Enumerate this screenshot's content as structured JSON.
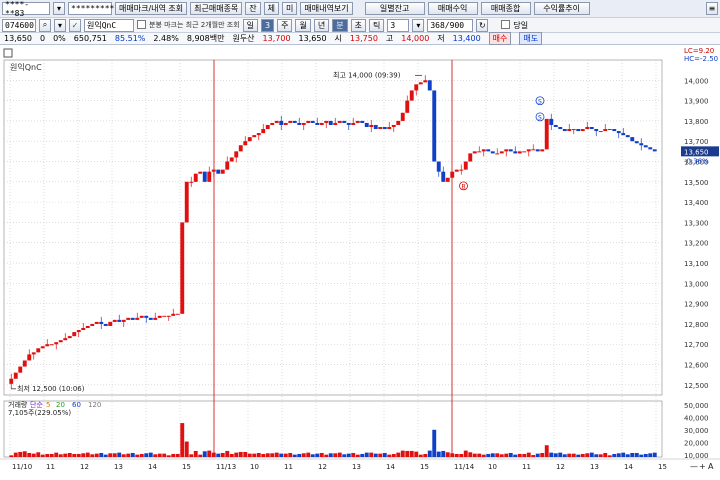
{
  "toolbar": {
    "account": "****-**83",
    "password": "*********",
    "buttons_left": [
      "매매마크/내역 조회",
      "최근매매종목",
      "잔",
      "체",
      "미",
      "매매내역보기"
    ],
    "buttons_right": [
      "일별잔고",
      "매매수익",
      "매매종합",
      "수익률추이"
    ],
    "menu_icon": "hamburger-icon"
  },
  "controls": {
    "stock_code": "074600",
    "stock_name": "원익QnC",
    "notice": "분봉 마크는 최근 2개월만 조회",
    "period_buttons": [
      "일",
      "3",
      "주",
      "월",
      "년",
      "분",
      "초",
      "틱"
    ],
    "selected_period": "분",
    "interval_value": "3",
    "count": "368/900",
    "single_label": "당일"
  },
  "quote": {
    "price": "13,650",
    "change": "0",
    "change_rate": "0%",
    "volume": "650,751",
    "volume_ratio": "85.51%",
    "turnover": "2.48%",
    "amount": "8,908백만",
    "investor": "원두산",
    "prev_close": "13,700",
    "current": "13,650",
    "open_label": "시",
    "open": "13,750",
    "high_label": "고",
    "high": "14,000",
    "low_label": "저",
    "low": "13,400",
    "buy_button": "매수",
    "sell_button": "매도"
  },
  "chart_data": {
    "type": "candlestick",
    "title": "원익QnC",
    "interval": "3분",
    "y_axis": {
      "min": 12450,
      "max": 14100,
      "ticks": [
        "14,000",
        "13,900",
        "13,800",
        "13,700",
        "13,600",
        "13,500",
        "13,400",
        "13,300",
        "13,200",
        "13,100",
        "13,000",
        "12,900",
        "12,800",
        "12,700",
        "12,600",
        "12,500"
      ]
    },
    "current_tag": {
      "value": "13,650",
      "change": "-0.36%"
    },
    "top_right_labels": [
      "LC=9.20",
      "HC=-2.50"
    ],
    "annotations": {
      "high": {
        "text": "최고 14,000 (09:39)",
        "value": 14000
      },
      "low": {
        "text": "최저 12,500 (10:06)",
        "value": 12500
      },
      "markers": [
        "S",
        "S",
        "B"
      ]
    },
    "closes": [
      12530,
      12560,
      12590,
      12620,
      12650,
      12660,
      12680,
      12690,
      12700,
      12700,
      12710,
      12720,
      12730,
      12740,
      12760,
      12770,
      12780,
      12790,
      12800,
      12810,
      12800,
      12790,
      12810,
      12820,
      12810,
      12820,
      12830,
      12820,
      12830,
      12840,
      12830,
      12820,
      12830,
      12840,
      12840,
      12840,
      12850,
      12850,
      13300,
      13500,
      13500,
      13540,
      13550,
      13500,
      13550,
      13560,
      13540,
      13560,
      13600,
      13620,
      13650,
      13680,
      13700,
      13720,
      13730,
      13740,
      13760,
      13780,
      13790,
      13800,
      13780,
      13790,
      13800,
      13790,
      13780,
      13790,
      13800,
      13790,
      13780,
      13790,
      13800,
      13780,
      13790,
      13800,
      13790,
      13780,
      13790,
      13800,
      13790,
      13770,
      13780,
      13760,
      13770,
      13760,
      13770,
      13780,
      13800,
      13840,
      13900,
      13950,
      13980,
      13990,
      14000,
      13950,
      13600,
      13550,
      13500,
      13520,
      13550,
      13560,
      13560,
      13600,
      13640,
      13650,
      13650,
      13660,
      13650,
      13640,
      13640,
      13650,
      13660,
      13650,
      13640,
      13650,
      13650,
      13660,
      13660,
      13650,
      13660,
      13810,
      13780,
      13770,
      13760,
      13750,
      13760,
      13760,
      13750,
      13760,
      13770,
      13760,
      13750,
      13750,
      13760,
      13760,
      13750,
      13740,
      13730,
      13720,
      13700,
      13690,
      13680,
      13670,
      13660,
      13650
    ],
    "volume_panel": {
      "legend": [
        "거래량",
        "단순",
        "5",
        "20",
        "60",
        "120"
      ],
      "value_label": "7,105주(229.05%)",
      "y_ticks": [
        "50,000",
        "40,000",
        "30,000",
        "20,000",
        "10,000"
      ],
      "current": "7,105",
      "ratio": "229.05%"
    },
    "x_labels": [
      "11/10",
      "11",
      "12",
      "13",
      "14",
      "15",
      "11/13",
      "10",
      "11",
      "12",
      "13",
      "14",
      "15",
      "11/14",
      "10",
      "11",
      "12",
      "13",
      "14",
      "15"
    ],
    "session_dividers": [
      "11/13",
      "11/14"
    ]
  },
  "bottom_controls": [
    "—",
    "+",
    "A"
  ]
}
